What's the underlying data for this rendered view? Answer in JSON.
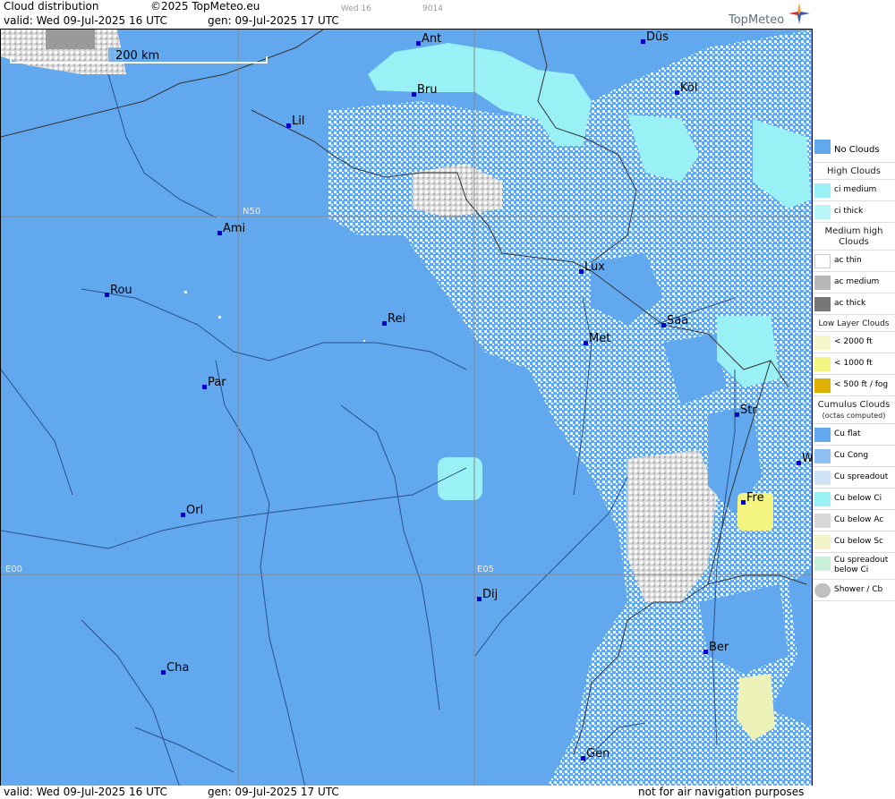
{
  "header": {
    "title": "Cloud distribution",
    "copyright": "©2025 TopMeteo.eu",
    "valid": "valid:  Wed  09-Jul-2025  16 UTC",
    "gen": "gen: 09-Jul-2025 17 UTC",
    "faint_day": "Wed 16",
    "faint_code": "9014",
    "brand": "TopMeteo"
  },
  "map": {
    "scale_label": "200 km",
    "grid_labels": {
      "lat": "N50",
      "lon0": "E00",
      "lon5": "E05"
    },
    "colors": {
      "sea_land": "#62a8ee",
      "ci": "#99f0f5",
      "ac": "#c8c8c8",
      "ac_medium": "#9a9a9a",
      "low_cloud": "#f4f480",
      "dots": "#ffffff"
    },
    "cities": [
      {
        "name": "Ant"
      },
      {
        "name": "Düs"
      },
      {
        "name": "Bru"
      },
      {
        "name": "Köl"
      },
      {
        "name": "Lil"
      },
      {
        "name": "Ami"
      },
      {
        "name": "Rou"
      },
      {
        "name": "Lux"
      },
      {
        "name": "Rei"
      },
      {
        "name": "Saa"
      },
      {
        "name": "Met"
      },
      {
        "name": "Par"
      },
      {
        "name": "Str"
      },
      {
        "name": "W"
      },
      {
        "name": "Fre"
      },
      {
        "name": "Orl"
      },
      {
        "name": "Dij"
      },
      {
        "name": "Ber"
      },
      {
        "name": "Cha"
      },
      {
        "name": "Gen"
      }
    ]
  },
  "footer": {
    "valid": "valid:  Wed  09-Jul-2025  16 UTC",
    "gen": "gen: 09-Jul-2025 17 UTC",
    "disclaimer": "not for air navigation purposes"
  },
  "legend": {
    "no_clouds": "No Clouds",
    "high_title": "High Clouds",
    "ci_medium": "ci medium",
    "ci_thick": "ci thick",
    "medium_title": "Medium high Clouds",
    "ac_thin": "ac thin",
    "ac_medium": "ac medium",
    "ac_thick": "ac thick",
    "low_title": "Low Layer Clouds",
    "low_2000": "< 2000 ft",
    "low_1000": "< 1000 ft",
    "low_500": "< 500 ft / fog",
    "cu_title": "Cumulus Clouds",
    "cu_sub": "(octas computed)",
    "cu_flat": "Cu flat",
    "cu_cong": "Cu Cong",
    "cu_spread": "Cu spreadout",
    "cu_below_ci": "Cu below Ci",
    "cu_below_ac": "Cu below Ac",
    "cu_below_sc": "Cu below Sc",
    "cu_spread_ci": "Cu spreadout below Ci",
    "shower": "Shower / Cb"
  }
}
